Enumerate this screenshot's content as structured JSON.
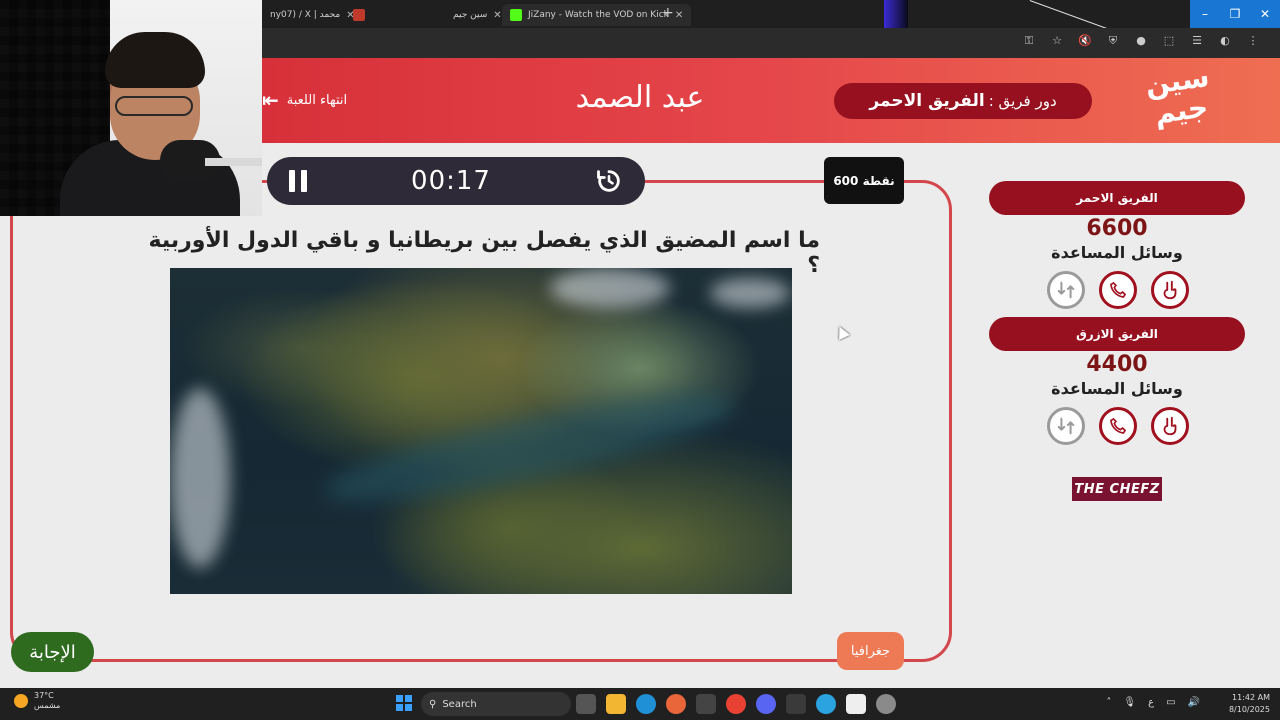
{
  "browser": {
    "tabs": [
      {
        "label": "ny07) / X | محمد",
        "close": "✕"
      },
      {
        "label": "",
        "close": ""
      },
      {
        "label": "سين جيم",
        "close": "✕"
      },
      {
        "label": "JiZany - Watch the VOD on Kick",
        "close": "✕"
      }
    ],
    "new_tab": "+"
  },
  "header": {
    "end_game_label": "انتهاء اللعبة",
    "player_name": "عبد الصمد",
    "turn_prefix": "دور فريق :",
    "turn_team": "الفريق الاحمر",
    "logo_text_1": "سين",
    "logo_text_2": "جيم"
  },
  "timer": {
    "value": "00:17"
  },
  "question": {
    "points": "600 نقطة",
    "text": "ما اسم المضيق الذي يفصل بين بريطانيا و باقي الدول الأوربية ؟",
    "category": "جغرافيا",
    "answer_label": "الإجابة"
  },
  "teams": [
    {
      "name": "الفريق الاحمر",
      "score": "6600",
      "help_label": "وسائل المساعدة"
    },
    {
      "name": "الفريق الازرق",
      "score": "4400",
      "help_label": "وسائل المساعدة"
    }
  ],
  "sponsor": {
    "text_1": "THE",
    "text_2": "CHEFZ"
  },
  "taskbar": {
    "temperature": "37°C",
    "weather_desc": "مشمس",
    "search_label": "Search",
    "time": "11:42 AM",
    "date": "8/10/2025",
    "lang": "ع"
  },
  "colors": {
    "accent_red": "#97101f",
    "header_gradient_start": "#d7303a",
    "header_gradient_end": "#ef6e52",
    "answer_green": "#2f6b1f",
    "category_orange": "#ee7a55"
  }
}
